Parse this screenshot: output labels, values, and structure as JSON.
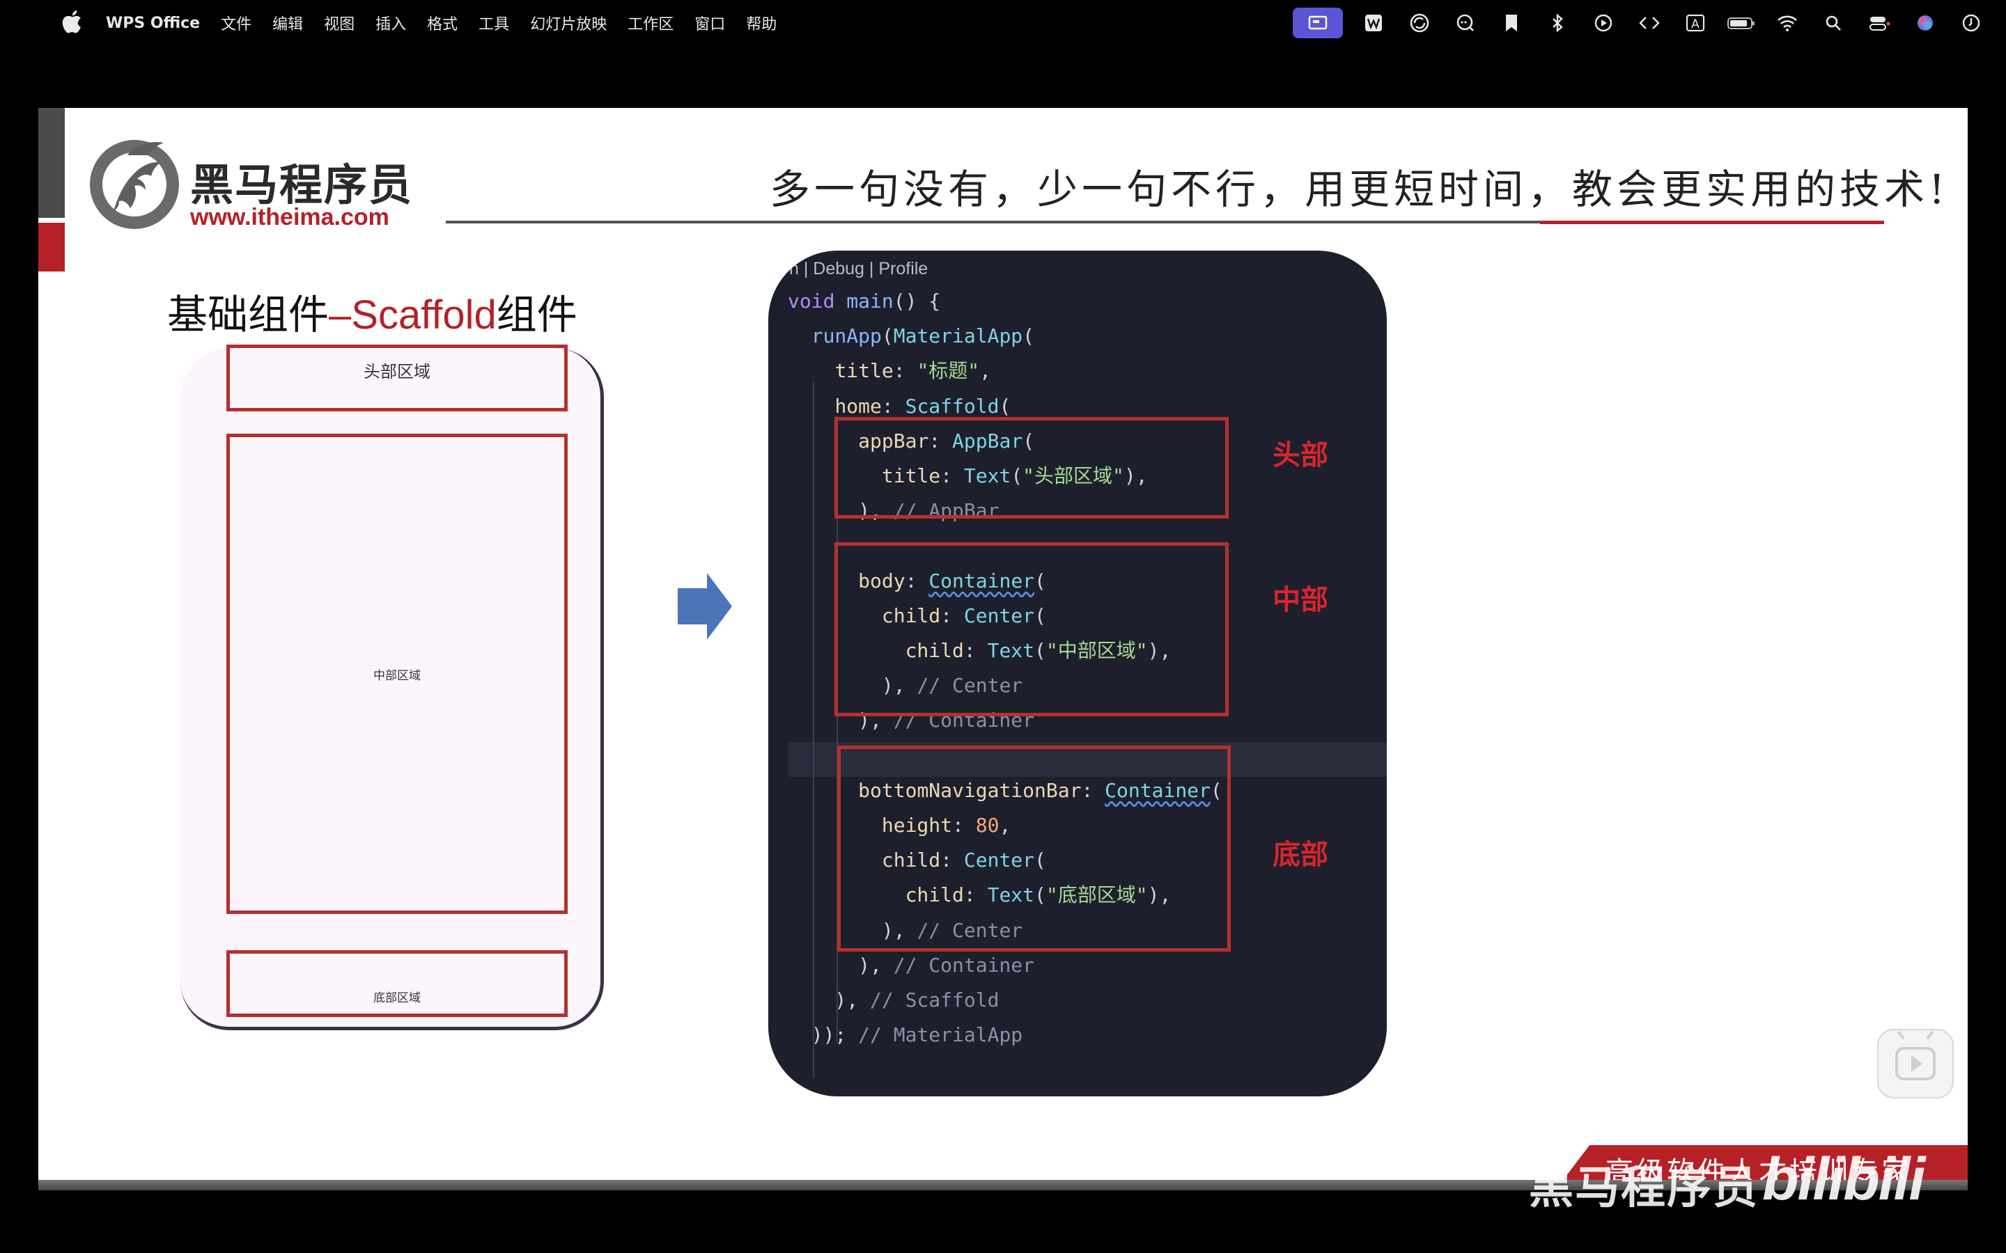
{
  "menubar": {
    "app_name": "WPS Office",
    "items": [
      "文件",
      "编辑",
      "视图",
      "插入",
      "格式",
      "工具",
      "幻灯片放映",
      "工作区",
      "窗口",
      "帮助"
    ],
    "status_icons": [
      "screen-record-icon",
      "wps-icon",
      "sync-icon",
      "chat-icon",
      "bookmark-icon",
      "bluetooth-icon",
      "play-circle-icon",
      "code-icon",
      "input-source-icon",
      "battery-icon",
      "wifi-icon",
      "search-icon",
      "control-center-icon",
      "siri-icon",
      "clock-icon"
    ],
    "input_source_label": "A",
    "accent_color": "#5a55d6"
  },
  "slide": {
    "logo_text": "黑马程序员",
    "logo_url": "www.itheima.com",
    "slogan": "多一句没有，少一句不行，用更短时间，教会更实用的技术!",
    "title_prefix": "基础组件",
    "title_accent": "–Scaffold",
    "title_suffix": "组件",
    "phone": {
      "head_label": "头部区域",
      "body_label": "中部区域",
      "bottom_label": "底部区域"
    },
    "code": {
      "codelens": "n | Debug | Profile",
      "labels": {
        "head": "头部",
        "body": "中部",
        "bottom": "底部"
      }
    },
    "tagline": "高级软件人才培训专家",
    "accent_color": "#b52127"
  },
  "overlay": {
    "watermark_logo": "黑马程序员",
    "watermark_bili": "bilibili"
  }
}
